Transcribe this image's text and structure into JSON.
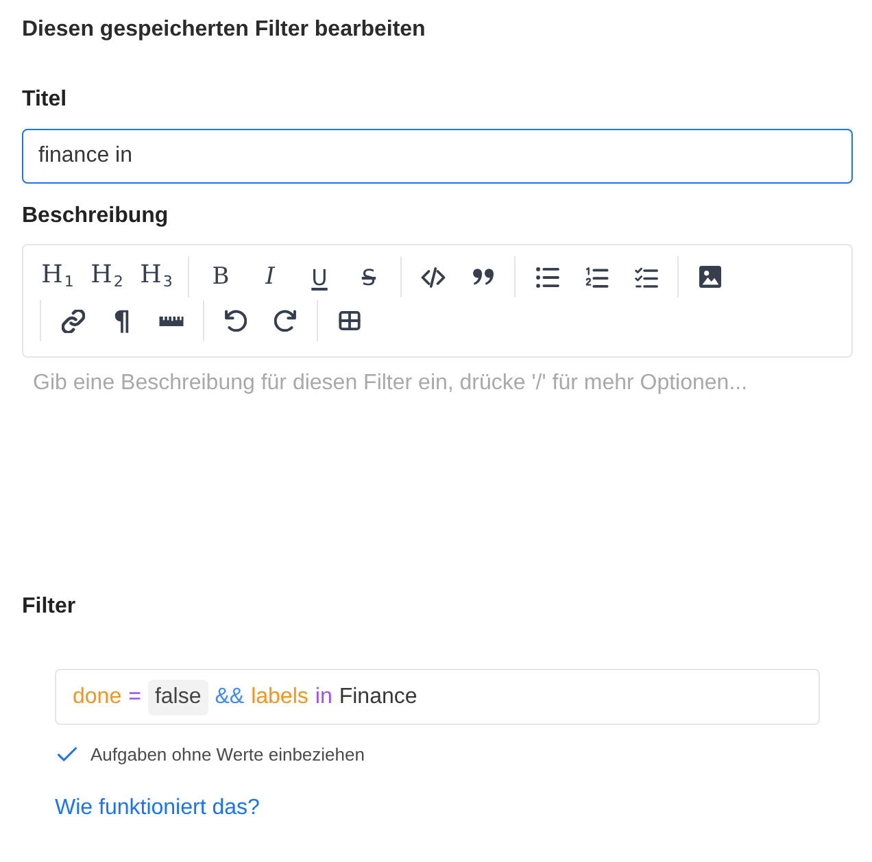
{
  "heading": "Diesen gespeicherten Filter bearbeiten",
  "title_field": {
    "label": "Titel",
    "value": "finance in",
    "focused": true
  },
  "description": {
    "label": "Beschreibung",
    "toolbar": [
      [
        {
          "kind": "heading",
          "label": "H$_{1}$"
        },
        {
          "kind": "heading",
          "label": "H$_{2}$"
        },
        {
          "kind": "heading",
          "label": "H$_{3}$"
        }
      ],
      [
        {
          "kind": "bold",
          "label": "B"
        },
        {
          "kind": "italic",
          "label": "I"
        },
        {
          "kind": "underline",
          "label": "U"
        },
        {
          "kind": "strike",
          "label": "S"
        }
      ],
      [
        {
          "kind": "code"
        },
        {
          "kind": "quote"
        }
      ],
      [
        {
          "kind": "bullet-list"
        },
        {
          "kind": "ordered-list"
        },
        {
          "kind": "task-list"
        }
      ],
      [
        {
          "kind": "image"
        }
      ],
      [
        {
          "kind": "link"
        },
        {
          "kind": "paragraph",
          "label": "¶"
        },
        {
          "kind": "ruler"
        }
      ],
      [
        {
          "kind": "undo"
        },
        {
          "kind": "redo"
        }
      ],
      [
        {
          "kind": "table"
        }
      ]
    ],
    "placeholder": "Gib eine Beschreibung für diesen Filter ein, drücke '/' für mehr Optionen..."
  },
  "filter": {
    "label": "Filter",
    "query": [
      {
        "kind": "field",
        "text": "done"
      },
      {
        "kind": "operator",
        "text": "="
      },
      {
        "kind": "value",
        "text": "false"
      },
      {
        "kind": "logic",
        "text": "&&"
      },
      {
        "kind": "field",
        "text": "labels"
      },
      {
        "kind": "operator",
        "text": "in"
      },
      {
        "kind": "plain",
        "text": "Finance"
      }
    ],
    "include_empty": {
      "label": "Aufgaben ohne Werte einbeziehen",
      "checked": true
    },
    "help_link": "Wie funktioniert das?"
  }
}
